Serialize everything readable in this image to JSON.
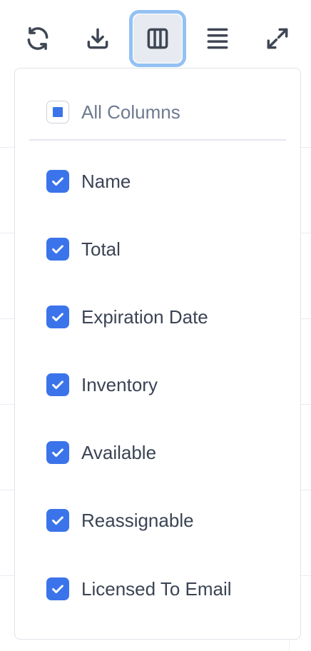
{
  "toolbar": {
    "buttons": [
      {
        "name": "refresh",
        "icon": "refresh-icon",
        "active": false
      },
      {
        "name": "download",
        "icon": "download-icon",
        "active": false
      },
      {
        "name": "columns",
        "icon": "columns-icon",
        "active": true
      },
      {
        "name": "density",
        "icon": "rows-icon",
        "active": false
      },
      {
        "name": "fullscreen",
        "icon": "expand-icon",
        "active": false
      }
    ]
  },
  "column_menu": {
    "all_columns": {
      "label": "All Columns",
      "state": "indeterminate"
    },
    "columns": [
      {
        "label": "Name",
        "checked": true
      },
      {
        "label": "Total",
        "checked": true
      },
      {
        "label": "Expiration Date",
        "checked": true
      },
      {
        "label": "Inventory",
        "checked": true
      },
      {
        "label": "Available",
        "checked": true
      },
      {
        "label": "Reassignable",
        "checked": true
      },
      {
        "label": "Licensed To Email",
        "checked": true
      }
    ]
  },
  "colors": {
    "accent": "#3b74ea",
    "focus_ring": "#93c1f4",
    "active_bg": "#e7ebf1",
    "text": "#3b4454",
    "muted_text": "#6e7a8f",
    "border": "#dfe3e9"
  }
}
